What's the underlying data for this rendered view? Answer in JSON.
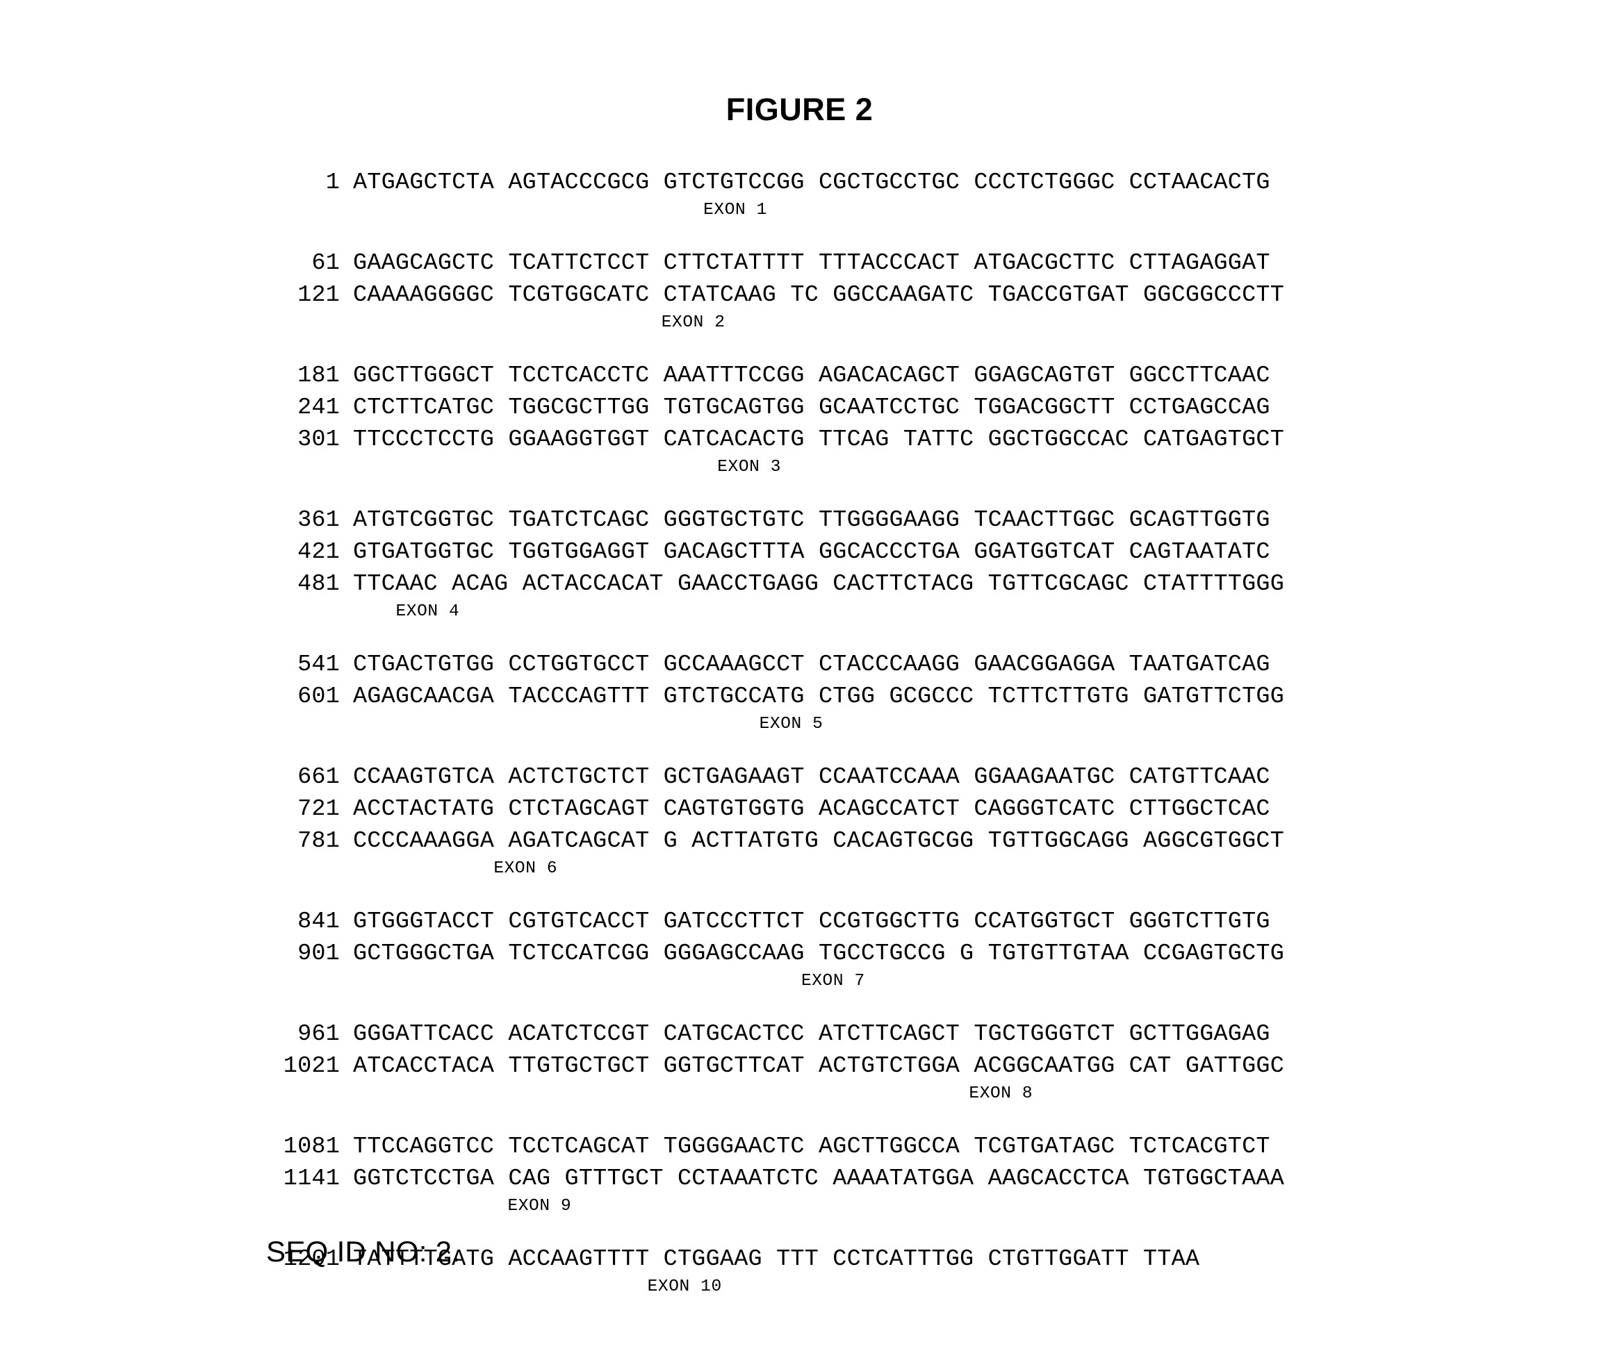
{
  "figure": {
    "title": "FIGURE 2",
    "seq_id_footer": "SEQ ID NO: 2."
  },
  "sequence": {
    "groups": [
      {
        "lines": [
          {
            "number": "1",
            "bases": "ATGAGCTCTA AGTACCCGCG GTCTGTCCGG CGCTGCCTGC CCCTCTGGGC CCTAACACTG"
          }
        ],
        "exon_label": "EXON 1",
        "exon_indent": 26
      },
      {
        "lines": [
          {
            "number": "61",
            "bases": "GAAGCAGCTC TCATTCTCCT CTTCTATTTT TTTACCCACT ATGACGCTTC CTTAGAGGAT"
          },
          {
            "number": "121",
            "bases": "CAAAAGGGGC TCGTGGCATC CTATCAAG TC GGCCAAGATC TGACCGTGAT GGCGGCCCTT"
          }
        ],
        "exon_label": "EXON 2",
        "exon_indent": 23
      },
      {
        "lines": [
          {
            "number": "181",
            "bases": "GGCTTGGGCT TCCTCACCTC AAATTTCCGG AGACACAGCT GGAGCAGTGT GGCCTTCAAC"
          },
          {
            "number": "241",
            "bases": "CTCTTCATGC TGGCGCTTGG TGTGCAGTGG GCAATCCTGC TGGACGGCTT CCTGAGCCAG"
          },
          {
            "number": "301",
            "bases": "TTCCCTCCTG GGAAGGTGGT CATCACACTG TTCAG TATTC GGCTGGCCAC CATGAGTGCT"
          }
        ],
        "exon_label": "EXON 3",
        "exon_indent": 27
      },
      {
        "lines": [
          {
            "number": "361",
            "bases": "ATGTCGGTGC TGATCTCAGC GGGTGCTGTC TTGGGGAAGG TCAACTTGGC GCAGTTGGTG"
          },
          {
            "number": "421",
            "bases": "GTGATGGTGC TGGTGGAGGT GACAGCTTTA GGCACCCTGA GGATGGTCAT CAGTAATATC"
          },
          {
            "number": "481",
            "bases": "TTCAAC ACAG ACTACCACAT GAACCTGAGG CACTTCTACG TGTTCGCAGC CTATTTTGGG"
          }
        ],
        "exon_label": "EXON 4",
        "exon_indent": 4
      },
      {
        "lines": [
          {
            "number": "541",
            "bases": "CTGACTGTGG CCTGGTGCCT GCCAAAGCCT CTACCCAAGG GAACGGAGGA TAATGATCAG"
          },
          {
            "number": "601",
            "bases": "AGAGCAACGA TACCCAGTTT GTCTGCCATG CTGG GCGCCC TCTTCTTGTG GATGTTCTGG"
          }
        ],
        "exon_label": "EXON 5",
        "exon_indent": 30
      },
      {
        "lines": [
          {
            "number": "661",
            "bases": "CCAAGTGTCA ACTCTGCTCT GCTGAGAAGT CCAATCCAAA GGAAGAATGC CATGTTCAAC"
          },
          {
            "number": "721",
            "bases": "ACCTACTATG CTCTAGCAGT CAGTGTGGTG ACAGCCATCT CAGGGTCATC CTTGGCTCAC"
          },
          {
            "number": "781",
            "bases": "CCCCAAAGGA AGATCAGCAT G ACTTATGTG CACAGTGCGG TGTTGGCAGG AGGCGTGGCT"
          }
        ],
        "exon_label": "EXON 6",
        "exon_indent": 11
      },
      {
        "lines": [
          {
            "number": "841",
            "bases": "GTGGGTACCT CGTGTCACCT GATCCCTTCT CCGTGGCTTG CCATGGTGCT GGGTCTTGTG"
          },
          {
            "number": "901",
            "bases": "GCTGGGCTGA TCTCCATCGG GGGAGCCAAG TGCCTGCCG G TGTGTTGTAA CCGAGTGCTG"
          }
        ],
        "exon_label": "EXON 7",
        "exon_indent": 33
      },
      {
        "lines": [
          {
            "number": "961",
            "bases": "GGGATTCACC ACATCTCCGT CATGCACTCC ATCTTCAGCT TGCTGGGTCT GCTTGGAGAG"
          },
          {
            "number": "1021",
            "bases": "ATCACCTACA TTGTGCTGCT GGTGCTTCAT ACTGTCTGGA ACGGCAATGG CAT GATTGGC"
          }
        ],
        "exon_label": "EXON 8",
        "exon_indent": 45
      },
      {
        "lines": [
          {
            "number": "1081",
            "bases": "TTCCAGGTCC TCCTCAGCAT TGGGGAACTC AGCTTGGCCA TCGTGATAGC TCTCACGTCT"
          },
          {
            "number": "1141",
            "bases": "GGTCTCCTGA CAG GTTTGCT CCTAAATCTC AAAATATGGA AAGCACCTCA TGTGGCTAAA"
          }
        ],
        "exon_label": "EXON 9",
        "exon_indent": 12
      },
      {
        "lines": [
          {
            "number": "1201",
            "bases": "TATTTTGATG ACCAAGTTTT CTGGAAG TTT CCTCATTTGG CTGTTGGATT TTAA"
          }
        ],
        "exon_label": "EXON 10",
        "exon_indent": 22
      }
    ]
  }
}
